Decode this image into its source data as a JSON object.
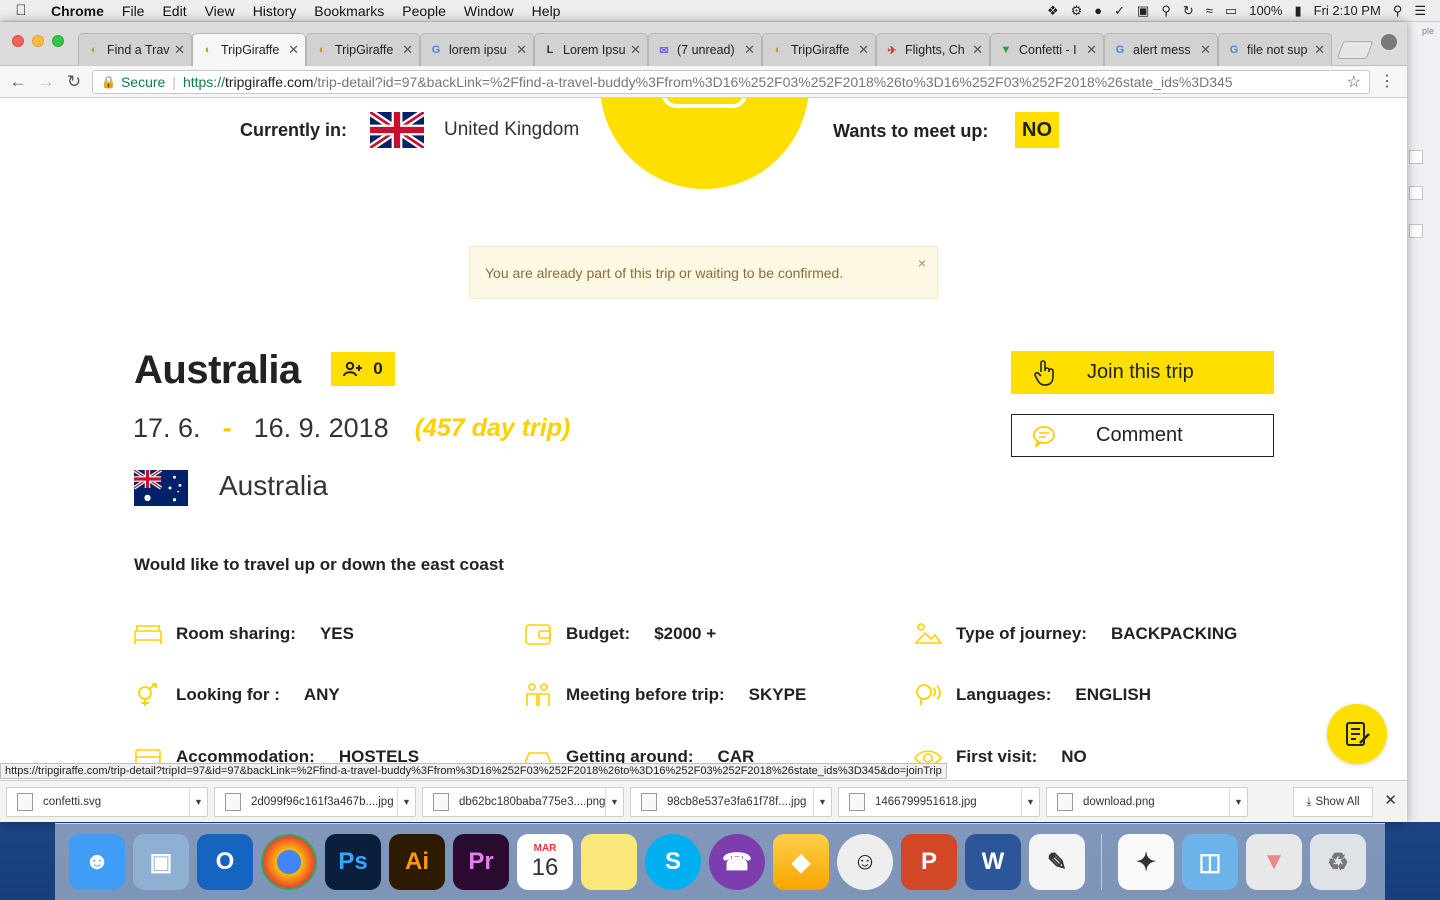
{
  "menubar": {
    "app": "Chrome",
    "menus": [
      "File",
      "Edit",
      "View",
      "History",
      "Bookmarks",
      "People",
      "Window",
      "Help"
    ],
    "battery": "100%",
    "clock": "Fri 2:10 PM"
  },
  "tabs": [
    {
      "title": "Find a Trav",
      "icon": "tripgiraffe-icon"
    },
    {
      "title": "TripGiraffe",
      "icon": "tripgiraffe-icon",
      "active": true
    },
    {
      "title": "TripGiraffe",
      "icon": "tripgiraffe-icon"
    },
    {
      "title": "lorem ipsu",
      "icon": "google-icon"
    },
    {
      "title": "Lorem Ipsu",
      "icon": "lipsum-icon"
    },
    {
      "title": "(7 unread)",
      "icon": "mail-icon"
    },
    {
      "title": "TripGiraffe",
      "icon": "tripgiraffe-icon"
    },
    {
      "title": "Flights, Ch",
      "icon": "flights-icon"
    },
    {
      "title": "Confetti - I",
      "icon": "vector-icon"
    },
    {
      "title": "alert mess",
      "icon": "google-icon"
    },
    {
      "title": "file not sup",
      "icon": "google-icon"
    }
  ],
  "address": {
    "secure_label": "Secure",
    "protocol": "https://",
    "host": "tripgiraffe.com",
    "path": "/trip-detail?id=97&backLink=%2Ffind-a-travel-buddy%3Ffrom%3D16%252F03%252F2018%26to%3D16%252F03%252F2018%26state_ids%3D345"
  },
  "page": {
    "currently_in_label": "Currently in:",
    "currently_in_value": "United Kingdom",
    "meet_up_label": "Wants to meet up:",
    "meet_up_value": "NO",
    "alert_text": "You are already part of this trip or waiting to be confirmed.",
    "alert_close": "×",
    "destination_title": "Australia",
    "buddy_count": "0",
    "date_start": "17. 6.",
    "date_sep": "-",
    "date_end": "16. 9. 2018",
    "duration": "(457 day trip)",
    "country": "Australia",
    "description": "Would like to travel up or down the east coast",
    "join_label": "Join this trip",
    "comment_label": "Comment",
    "attributes": [
      {
        "label": "Room sharing:",
        "value": "YES",
        "icon": "bed-icon"
      },
      {
        "label": "Budget:",
        "value": "$2000 +",
        "icon": "wallet-icon"
      },
      {
        "label": "Type of journey:",
        "value": "BACKPACKING",
        "icon": "journey-icon"
      },
      {
        "label": "Looking for :",
        "value": "ANY",
        "icon": "gender-icon"
      },
      {
        "label": "Meeting before trip:",
        "value": "SKYPE",
        "icon": "meeting-icon"
      },
      {
        "label": "Languages:",
        "value": "ENGLISH",
        "icon": "speech-icon"
      },
      {
        "label": "Accommodation:",
        "value": "HOSTELS",
        "icon": "accommodation-icon"
      },
      {
        "label": "Getting around:",
        "value": "CAR",
        "icon": "car-icon"
      },
      {
        "label": "First visit:",
        "value": "NO",
        "icon": "eye-icon"
      }
    ]
  },
  "status_url": "https://tripgiraffe.com/trip-detail?tripId=97&id=97&backLink=%2Ffind-a-travel-buddy%3Ffrom%3D16%252F03%252F2018%26to%3D16%252F03%252F2018%26state_ids%3D345&do=joinTrip",
  "downloads": [
    "confetti.svg",
    "2d099f96c161f3a467b....jpg",
    "db62bc180baba775e3....png",
    "98cb8e537e3fa61f78f....jpg",
    "1466799951618.jpg",
    "download.png"
  ],
  "show_all_label": "Show All",
  "dock_calendar": {
    "month": "MAR",
    "day": "16"
  },
  "colors": {
    "brand_yellow": "#ffdf00",
    "alert_bg": "#fcf8e3",
    "alert_text": "#8a6d3b"
  }
}
